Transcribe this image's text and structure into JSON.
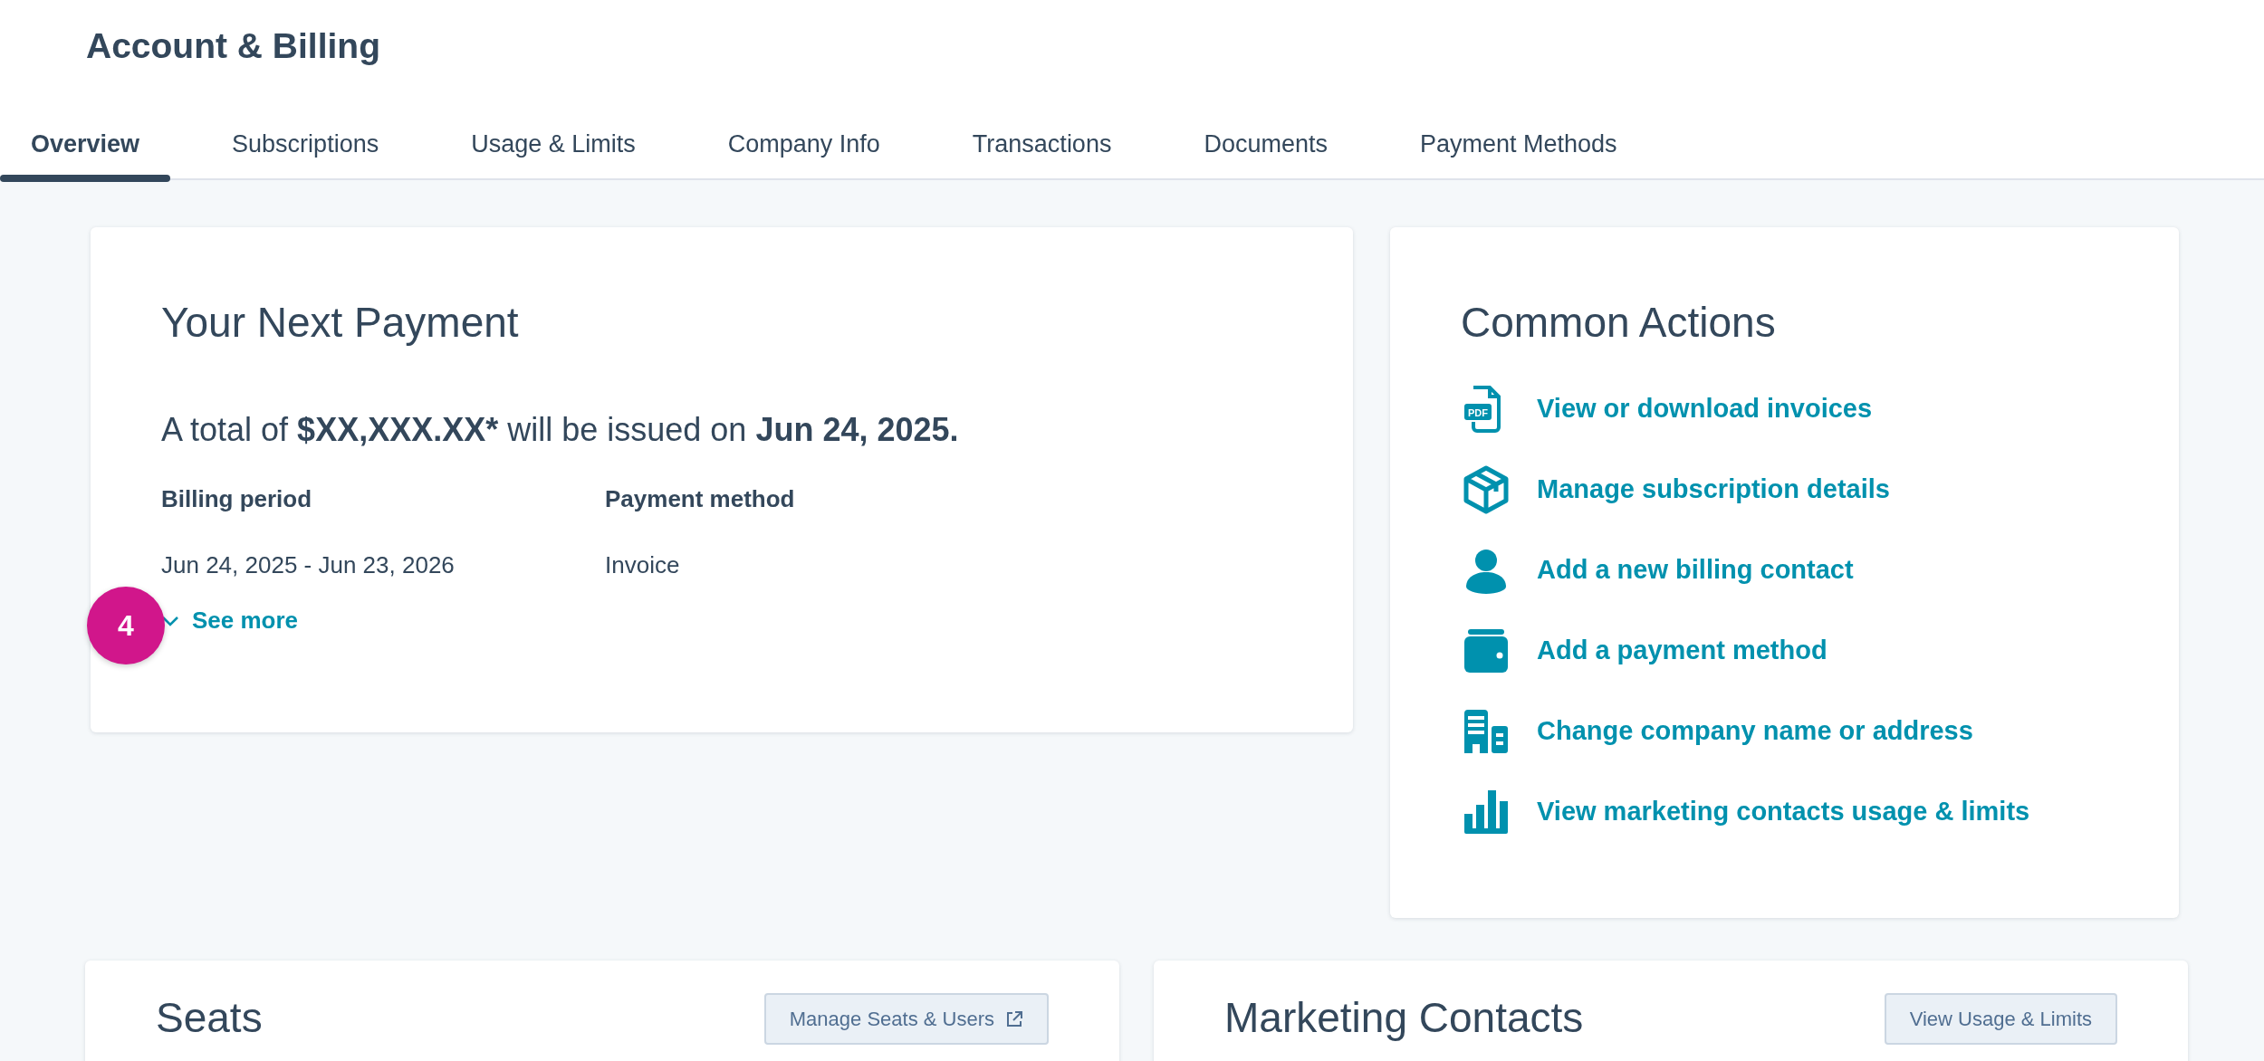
{
  "page": {
    "title": "Account & Billing"
  },
  "tabs": [
    {
      "label": "Overview",
      "selected": true
    },
    {
      "label": "Subscriptions",
      "selected": false
    },
    {
      "label": "Usage & Limits",
      "selected": false
    },
    {
      "label": "Company Info",
      "selected": false
    },
    {
      "label": "Transactions",
      "selected": false
    },
    {
      "label": "Documents",
      "selected": false
    },
    {
      "label": "Payment Methods",
      "selected": false
    }
  ],
  "next_payment": {
    "title": "Your Next Payment",
    "summary": [
      {
        "text": "A total of ",
        "bold": false
      },
      {
        "text": "$XX,XXX.XX*",
        "bold": true
      },
      {
        "text": " will be issued on ",
        "bold": false
      },
      {
        "text": "Jun 24, 2025.",
        "bold": true
      }
    ],
    "fields": [
      {
        "label": "Billing period",
        "value": "Jun 24, 2025 - Jun 23, 2026"
      },
      {
        "label": "Payment method",
        "value": "Invoice"
      }
    ],
    "see_more": {
      "label": "See more",
      "expanded": false
    }
  },
  "step_badge": "4",
  "common_actions": {
    "title": "Common Actions",
    "items": [
      {
        "kind": "pdf",
        "label": "View or download invoices",
        "icon_text": "PDF"
      },
      {
        "kind": "box",
        "label": "Manage subscription details"
      },
      {
        "kind": "person",
        "label": "Add a new billing contact"
      },
      {
        "kind": "wallet",
        "label": "Add a payment method"
      },
      {
        "kind": "building",
        "label": "Change company name or address"
      },
      {
        "kind": "chart",
        "label": "View marketing contacts usage & limits"
      }
    ]
  },
  "cards": [
    {
      "title": "Seats",
      "button": "Manage Seats & Users",
      "external": true
    },
    {
      "title": "Marketing Contacts",
      "button": "View Usage & Limits",
      "external": false
    }
  ]
}
